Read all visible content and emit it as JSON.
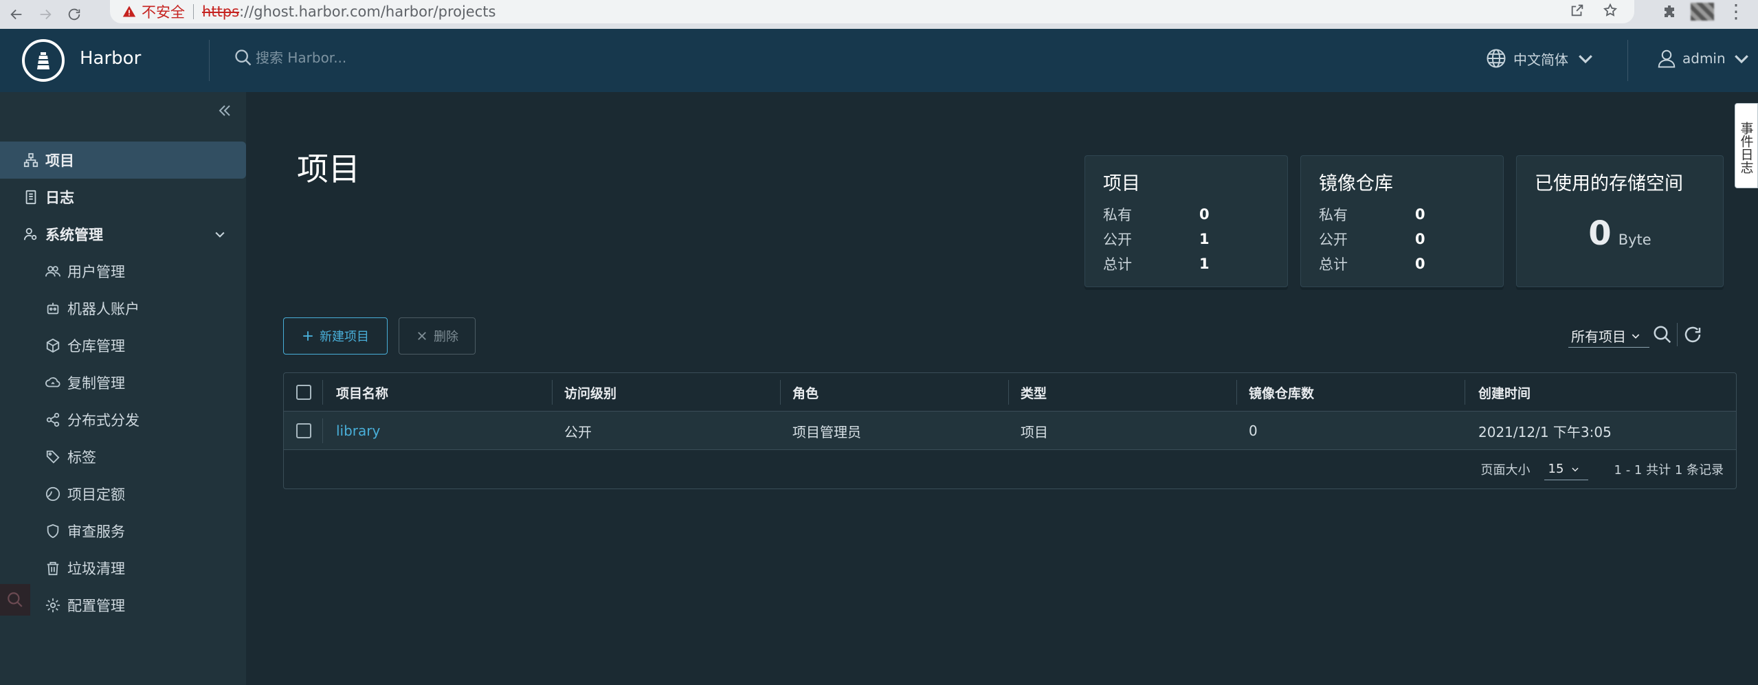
{
  "browser": {
    "insecure_label": "不安全",
    "url_scheme": "https",
    "url_rest": "://ghost.harbor.com/harbor/projects"
  },
  "header": {
    "brand": "Harbor",
    "search_placeholder": "搜索 Harbor...",
    "language": "中文简体",
    "user": "admin"
  },
  "sidebar": {
    "items": [
      {
        "label": "项目",
        "icon": "projects-icon",
        "active": true
      },
      {
        "label": "日志",
        "icon": "logs-icon"
      },
      {
        "label": "系统管理",
        "icon": "admin-icon",
        "expanded": true
      }
    ],
    "sub_items": [
      {
        "label": "用户管理",
        "icon": "users-icon"
      },
      {
        "label": "机器人账户",
        "icon": "robot-icon"
      },
      {
        "label": "仓库管理",
        "icon": "registry-icon"
      },
      {
        "label": "复制管理",
        "icon": "replication-icon"
      },
      {
        "label": "分布式分发",
        "icon": "share-icon"
      },
      {
        "label": "标签",
        "icon": "tag-icon"
      },
      {
        "label": "项目定额",
        "icon": "quota-icon"
      },
      {
        "label": "审查服务",
        "icon": "shield-icon"
      },
      {
        "label": "垃圾清理",
        "icon": "trash-icon"
      },
      {
        "label": "配置管理",
        "icon": "gear-icon"
      }
    ]
  },
  "main": {
    "title": "项目",
    "cards": {
      "projects": {
        "title": "项目",
        "rows": [
          {
            "label": "私有",
            "value": "0"
          },
          {
            "label": "公开",
            "value": "1"
          },
          {
            "label": "总计",
            "value": "1"
          }
        ]
      },
      "repos": {
        "title": "镜像仓库",
        "rows": [
          {
            "label": "私有",
            "value": "0"
          },
          {
            "label": "公开",
            "value": "0"
          },
          {
            "label": "总计",
            "value": "0"
          }
        ]
      },
      "storage": {
        "title": "已使用的存储空间",
        "value": "0",
        "unit": "Byte"
      }
    },
    "toolbar": {
      "new_project": "新建项目",
      "delete": "删除",
      "filter": "所有项目"
    },
    "table": {
      "columns": [
        "项目名称",
        "访问级别",
        "角色",
        "类型",
        "镜像仓库数",
        "创建时间"
      ],
      "rows": [
        {
          "name": "library",
          "access": "公开",
          "role": "项目管理员",
          "type": "项目",
          "repo_count": "0",
          "created": "2021/12/1 下午3:05"
        }
      ],
      "footer": {
        "page_size_label": "页面大小",
        "page_size": "15",
        "summary": "1 - 1 共计 1 条记录"
      }
    }
  },
  "event_tab": "事件日志"
}
